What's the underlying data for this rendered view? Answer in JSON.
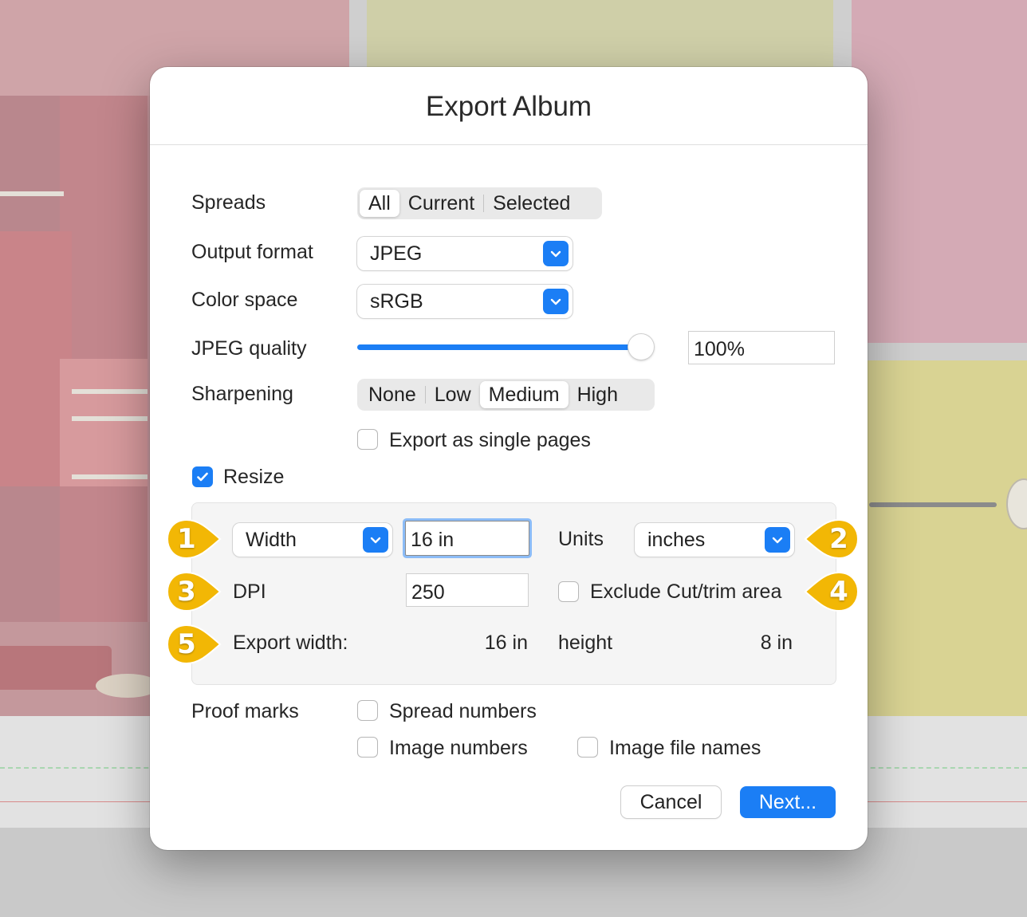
{
  "dialog": {
    "title": "Export Album",
    "spreads": {
      "label": "Spreads",
      "options": [
        "All",
        "Current",
        "Selected"
      ],
      "selected": "All"
    },
    "output_format": {
      "label": "Output format",
      "value": "JPEG"
    },
    "color_space": {
      "label": "Color space",
      "value": "sRGB"
    },
    "jpeg_quality": {
      "label": "JPEG quality",
      "value": "100%",
      "level": 1.0
    },
    "sharpening": {
      "label": "Sharpening",
      "options": [
        "None",
        "Low",
        "Medium",
        "High"
      ],
      "selected": "Medium"
    },
    "export_single_pages": {
      "label": "Export as single pages",
      "checked": false
    },
    "resize": {
      "label": "Resize",
      "checked": true,
      "dimension": "Width",
      "size_value": "16 in",
      "units_label": "Units",
      "units": "inches",
      "dpi_label": "DPI",
      "dpi": "250",
      "exclude_cut": {
        "label": "Exclude Cut/trim area",
        "checked": false
      },
      "export_width_label": "Export width:",
      "export_width": "16 in",
      "height_label": "height",
      "height": "8 in"
    },
    "proof_marks": {
      "label": "Proof marks",
      "spread_numbers": {
        "label": "Spread numbers",
        "checked": false
      },
      "image_numbers": {
        "label": "Image numbers",
        "checked": false
      },
      "image_file_names": {
        "label": "Image file names",
        "checked": false
      }
    },
    "buttons": {
      "cancel": "Cancel",
      "next": "Next..."
    }
  },
  "callouts": [
    "1",
    "2",
    "3",
    "4",
    "5"
  ],
  "colors": {
    "accent": "#1b7ef5",
    "callout": "#f2b705"
  }
}
